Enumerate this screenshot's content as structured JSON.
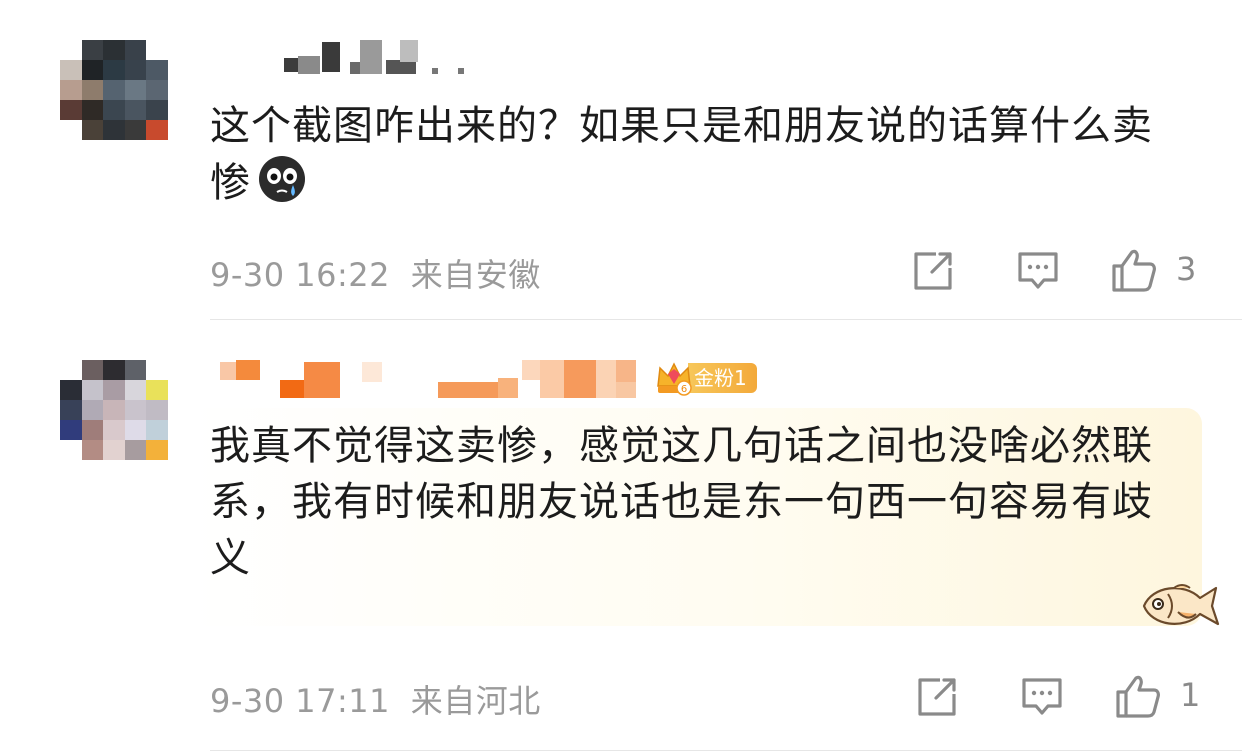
{
  "comments": [
    {
      "text": "这个截图咋出来的？如果只是和朋友说的话算什么卖惨",
      "emoji_icon": "crying-face-icon",
      "time": "9-30 16:22",
      "location": "来自安徽",
      "like_count": "3"
    },
    {
      "badge": {
        "label": "金粉1",
        "level": "6",
        "icon": "crown-icon",
        "color": "#f3a93a"
      },
      "text": "我真不觉得这卖惨，感觉这几句话之间也没啥必然联系，我有时候和朋友说话也是东一句西一句容易有歧义",
      "time": "9-30 17:11",
      "location": "来自河北",
      "like_count": "1"
    }
  ],
  "icons": {
    "share": "share-icon",
    "reply": "comment-icon",
    "like": "thumbs-up-icon",
    "decoration": "fish-icon"
  },
  "colors": {
    "meta_text": "#9a9a9a",
    "badge_gold": "#f3a93a",
    "bubble_tint": "#fef6de"
  }
}
